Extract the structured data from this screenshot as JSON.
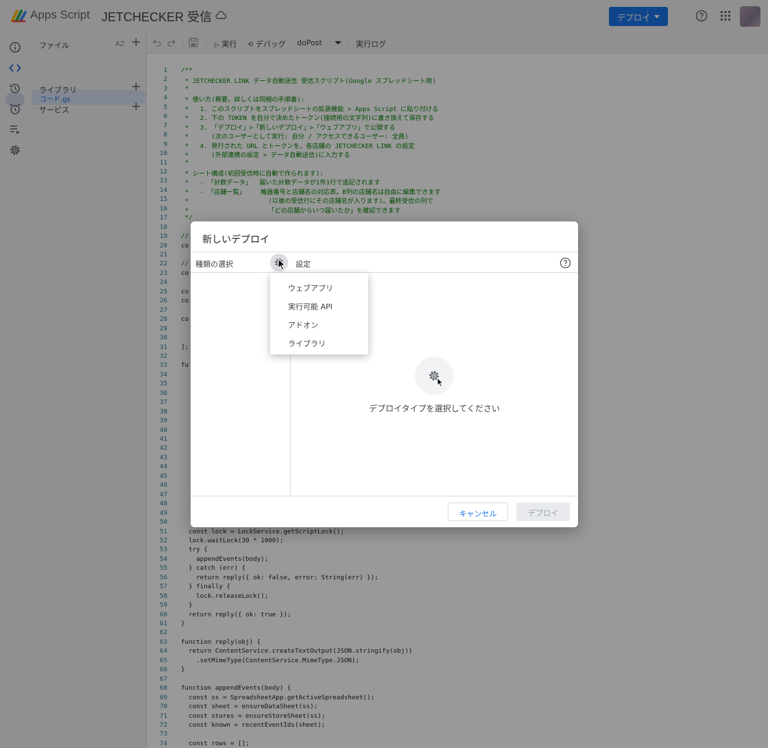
{
  "topbar": {
    "app_name": "Apps Script",
    "project_title": "JETCHECKER 受信",
    "deploy_label": "デプロイ"
  },
  "file_panel": {
    "files_label": "ファイル",
    "sort_label": "AZ",
    "file_name": "コード.gs",
    "libraries_label": "ライブラリ",
    "services_label": "サービス"
  },
  "toolbar": {
    "run_label": "実行",
    "debug_label": "デバッグ",
    "function_name": "doPost",
    "log_label": "実行ログ"
  },
  "editor": {
    "lines": [
      {
        "n": "1",
        "text": "/**",
        "cls": "cm"
      },
      {
        "n": "2",
        "text": " * JETCHECKER LINK データ自動送信 受信スクリプト(Google スプレッドシート用)",
        "cls": "cm"
      },
      {
        "n": "3",
        "text": " *",
        "cls": "cm"
      },
      {
        "n": "4",
        "text": " * 使い方(概要。詳しくは同梱の手順書):",
        "cls": "cm"
      },
      {
        "n": "5",
        "text": " *   1. このスクリプトをスプレッドシートの拡張機能 > Apps Script に貼り付ける",
        "cls": "cm"
      },
      {
        "n": "6",
        "text": " *   2. 下の TOKEN を自分で決めたトークン(接続用の文字列)に書き換えて保存する",
        "cls": "cm"
      },
      {
        "n": "7",
        "text": " *   3. 「デプロイ」>「新しいデプロイ」>「ウェブアプリ」で公開する",
        "cls": "cm"
      },
      {
        "n": "8",
        "text": " *      (次のユーザーとして実行: 自分 / アクセスできるユーザー: 全員)",
        "cls": "cm"
      },
      {
        "n": "9",
        "text": " *   4. 発行された URL とトークンを、各店舗の JETCHECKER LINK の設定",
        "cls": "cm"
      },
      {
        "n": "10",
        "text": " *      (外部連携の設定 > データ自動送信)に入力する",
        "cls": "cm"
      },
      {
        "n": "11",
        "text": " *",
        "cls": "cm"
      },
      {
        "n": "12",
        "text": " * シート構成(初回受信時に自動で作られます):",
        "cls": "cm"
      },
      {
        "n": "13",
        "text": " *   - 「計数データ」  届いた計数データが1件1行で追記されます",
        "cls": "cm"
      },
      {
        "n": "14",
        "text": " *   - 「店舗一覧」    機器番号と店舗名の対応表。B列の店舗名は自由に編集できます",
        "cls": "cm"
      },
      {
        "n": "15",
        "text": " *                     (以後の受信行にその店舗名が入ります)。最終受信の列で",
        "cls": "cm"
      },
      {
        "n": "16",
        "text": " *                     「どの店舗からいつ届いたか」を確認できます",
        "cls": "cm"
      },
      {
        "n": "17",
        "text": " */",
        "cls": "cm"
      },
      {
        "n": "18",
        "text": "",
        "cls": ""
      },
      {
        "n": "19",
        "text": "//",
        "cls": "cm"
      },
      {
        "n": "20",
        "text": "co",
        "cls": ""
      },
      {
        "n": "21",
        "text": "",
        "cls": ""
      },
      {
        "n": "22",
        "text": "//",
        "cls": "cm"
      },
      {
        "n": "23",
        "text": "co",
        "cls": ""
      },
      {
        "n": "24",
        "text": "",
        "cls": ""
      },
      {
        "n": "25",
        "text": "co",
        "cls": ""
      },
      {
        "n": "26",
        "text": "co",
        "cls": ""
      },
      {
        "n": "27",
        "text": "",
        "cls": ""
      },
      {
        "n": "28",
        "text": "co",
        "cls": ""
      },
      {
        "n": "29",
        "text": "",
        "cls": ""
      },
      {
        "n": "30",
        "text": "",
        "cls": ""
      },
      {
        "n": "31",
        "text": "];",
        "cls": ""
      },
      {
        "n": "32",
        "text": "",
        "cls": ""
      },
      {
        "n": "33",
        "text": "fu",
        "cls": ""
      },
      {
        "n": "34",
        "text": "",
        "cls": ""
      },
      {
        "n": "35",
        "text": "",
        "cls": ""
      },
      {
        "n": "36",
        "text": "",
        "cls": ""
      },
      {
        "n": "37",
        "text": "",
        "cls": ""
      },
      {
        "n": "38",
        "text": "",
        "cls": ""
      },
      {
        "n": "39",
        "text": "",
        "cls": ""
      },
      {
        "n": "40",
        "text": "",
        "cls": ""
      },
      {
        "n": "41",
        "text": "",
        "cls": ""
      },
      {
        "n": "42",
        "text": "",
        "cls": ""
      },
      {
        "n": "43",
        "text": "",
        "cls": ""
      },
      {
        "n": "44",
        "text": "",
        "cls": ""
      },
      {
        "n": "45",
        "text": "",
        "cls": ""
      },
      {
        "n": "46",
        "text": "",
        "cls": ""
      },
      {
        "n": "47",
        "text": "",
        "cls": ""
      },
      {
        "n": "48",
        "text": "",
        "cls": ""
      },
      {
        "n": "49",
        "text": "",
        "cls": ""
      },
      {
        "n": "50",
        "text": "",
        "cls": ""
      },
      {
        "n": "51",
        "text": "  const lock = LockService.getScriptLock();",
        "cls": ""
      },
      {
        "n": "52",
        "text": "  lock.waitLock(30 * 1000);",
        "cls": ""
      },
      {
        "n": "53",
        "text": "  try {",
        "cls": ""
      },
      {
        "n": "54",
        "text": "    appendEvents(body);",
        "cls": ""
      },
      {
        "n": "55",
        "text": "  } catch (err) {",
        "cls": ""
      },
      {
        "n": "56",
        "text": "    return reply({ ok: false, error: String(err) });",
        "cls": ""
      },
      {
        "n": "57",
        "text": "  } finally {",
        "cls": ""
      },
      {
        "n": "58",
        "text": "    lock.releaseLock();",
        "cls": ""
      },
      {
        "n": "59",
        "text": "  }",
        "cls": ""
      },
      {
        "n": "60",
        "text": "  return reply({ ok: true });",
        "cls": ""
      },
      {
        "n": "61",
        "text": "}",
        "cls": ""
      },
      {
        "n": "62",
        "text": "",
        "cls": ""
      },
      {
        "n": "63",
        "text": "function reply(obj) {",
        "cls": ""
      },
      {
        "n": "64",
        "text": "  return ContentService.createTextOutput(JSON.stringify(obj))",
        "cls": ""
      },
      {
        "n": "65",
        "text": "    .setMimeType(ContentService.MimeType.JSON);",
        "cls": ""
      },
      {
        "n": "66",
        "text": "}",
        "cls": ""
      },
      {
        "n": "67",
        "text": "",
        "cls": ""
      },
      {
        "n": "68",
        "text": "function appendEvents(body) {",
        "cls": ""
      },
      {
        "n": "69",
        "text": "  const ss = SpreadsheetApp.getActiveSpreadsheet();",
        "cls": ""
      },
      {
        "n": "70",
        "text": "  const sheet = ensureDataSheet(ss);",
        "cls": ""
      },
      {
        "n": "71",
        "text": "  const stores = ensureStoreSheet(ss);",
        "cls": ""
      },
      {
        "n": "72",
        "text": "  const known = recentEventIds(sheet);",
        "cls": ""
      },
      {
        "n": "73",
        "text": "",
        "cls": ""
      },
      {
        "n": "74",
        "text": "  const rows = [];",
        "cls": ""
      }
    ]
  },
  "dialog": {
    "title": "新しいデプロイ",
    "type_label": "種類の選択",
    "settings_label": "設定",
    "empty_message": "デプロイタイプを選択してください",
    "cancel_label": "キャンセル",
    "deploy_label": "デプロイ"
  },
  "type_menu": {
    "items": [
      {
        "label": "ウェブアプリ"
      },
      {
        "label": "実行可能 API"
      },
      {
        "label": "アドオン"
      },
      {
        "label": "ライブラリ"
      }
    ]
  }
}
